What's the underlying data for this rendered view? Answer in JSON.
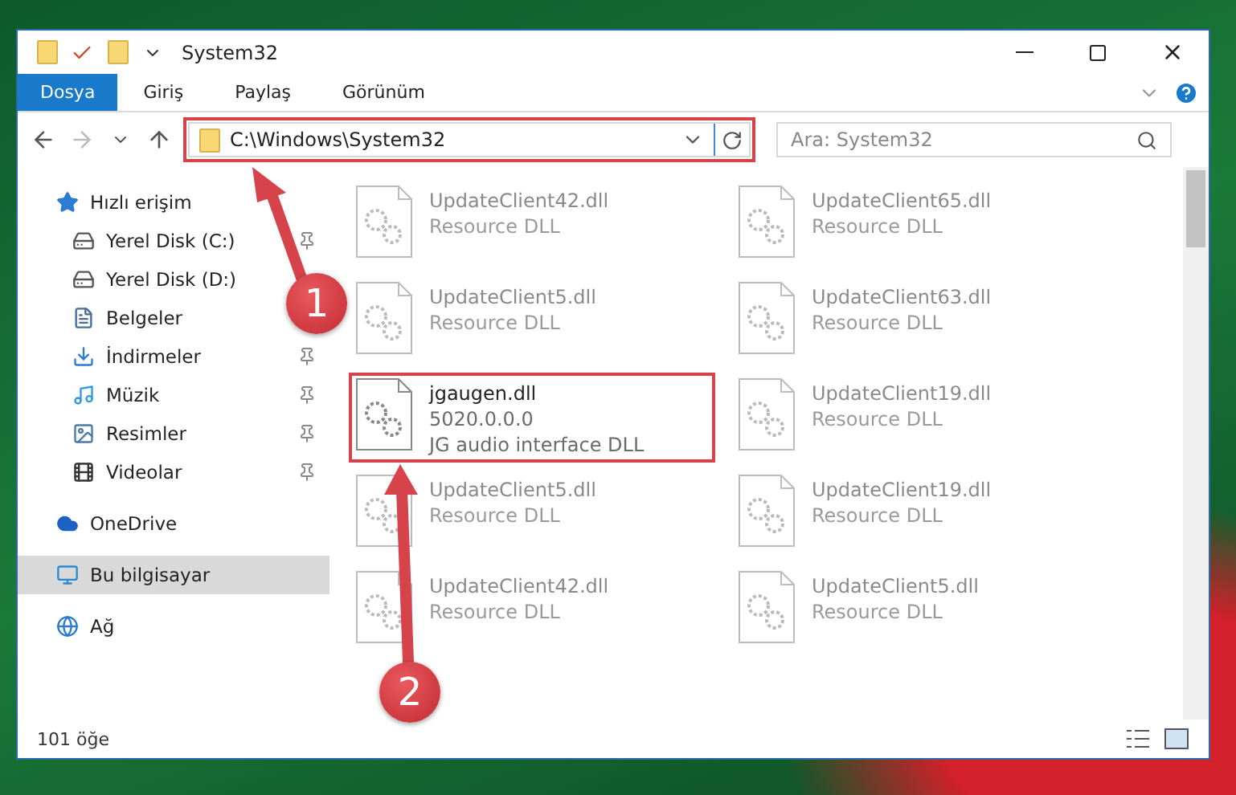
{
  "window": {
    "title": "System32"
  },
  "ribbon_tabs": [
    {
      "label": "Dosya",
      "selected": true
    },
    {
      "label": "Giriş",
      "selected": false
    },
    {
      "label": "Paylaş",
      "selected": false
    },
    {
      "label": "Görünüm",
      "selected": false
    }
  ],
  "address_bar": {
    "value": "C:\\Windows\\System32",
    "highlighted": true
  },
  "search": {
    "placeholder": "Ara: System32"
  },
  "sidebar": {
    "items": [
      {
        "label": "Hızlı erişim",
        "kind": "star",
        "selected": false,
        "children": [
          {
            "label": "Yerel Disk (C:)",
            "kind": "drive",
            "pinned": true
          },
          {
            "label": "Yerel Disk (D:)",
            "kind": "drive",
            "pinned": false
          },
          {
            "label": "Belgeler",
            "kind": "document",
            "pinned": false
          },
          {
            "label": "İndirmeler",
            "kind": "download",
            "pinned": true
          },
          {
            "label": "Müzik",
            "kind": "music",
            "pinned": true
          },
          {
            "label": "Resimler",
            "kind": "picture",
            "pinned": true
          },
          {
            "label": "Videolar",
            "kind": "video",
            "pinned": true
          }
        ]
      },
      {
        "label": "OneDrive",
        "kind": "cloud",
        "selected": false
      },
      {
        "label": "Bu bilgisayar",
        "kind": "computer",
        "selected": true
      },
      {
        "label": "Ağ",
        "kind": "network",
        "selected": false
      }
    ]
  },
  "files": [
    {
      "name": "UpdateClient42.dll",
      "details": [
        "Resource DLL"
      ],
      "faded": true,
      "highlighted": false
    },
    {
      "name": "UpdateClient65.dll",
      "details": [
        "Resource DLL"
      ],
      "faded": true,
      "highlighted": false
    },
    {
      "name": "UpdateClient5.dll",
      "details": [
        "Resource DLL"
      ],
      "faded": true,
      "highlighted": false
    },
    {
      "name": "UpdateClient63.dll",
      "details": [
        "Resource DLL"
      ],
      "faded": true,
      "highlighted": false
    },
    {
      "name": "jgaugen.dll",
      "details": [
        "5020.0.0.0",
        "JG audio interface DLL"
      ],
      "faded": false,
      "highlighted": true
    },
    {
      "name": "UpdateClient19.dll",
      "details": [
        "Resource DLL"
      ],
      "faded": true,
      "highlighted": false
    },
    {
      "name": "UpdateClient5.dll",
      "details": [
        "Resource DLL"
      ],
      "faded": true,
      "highlighted": false
    },
    {
      "name": "UpdateClient19.dll",
      "details": [
        "Resource DLL"
      ],
      "faded": true,
      "highlighted": false
    },
    {
      "name": "UpdateClient42.dll",
      "details": [
        "Resource DLL"
      ],
      "faded": true,
      "highlighted": false
    },
    {
      "name": "UpdateClient5.dll",
      "details": [
        "Resource DLL"
      ],
      "faded": true,
      "highlighted": false
    }
  ],
  "status_bar": {
    "count": "101 öğe"
  },
  "annotations": [
    {
      "number": "1"
    },
    {
      "number": "2"
    }
  ]
}
